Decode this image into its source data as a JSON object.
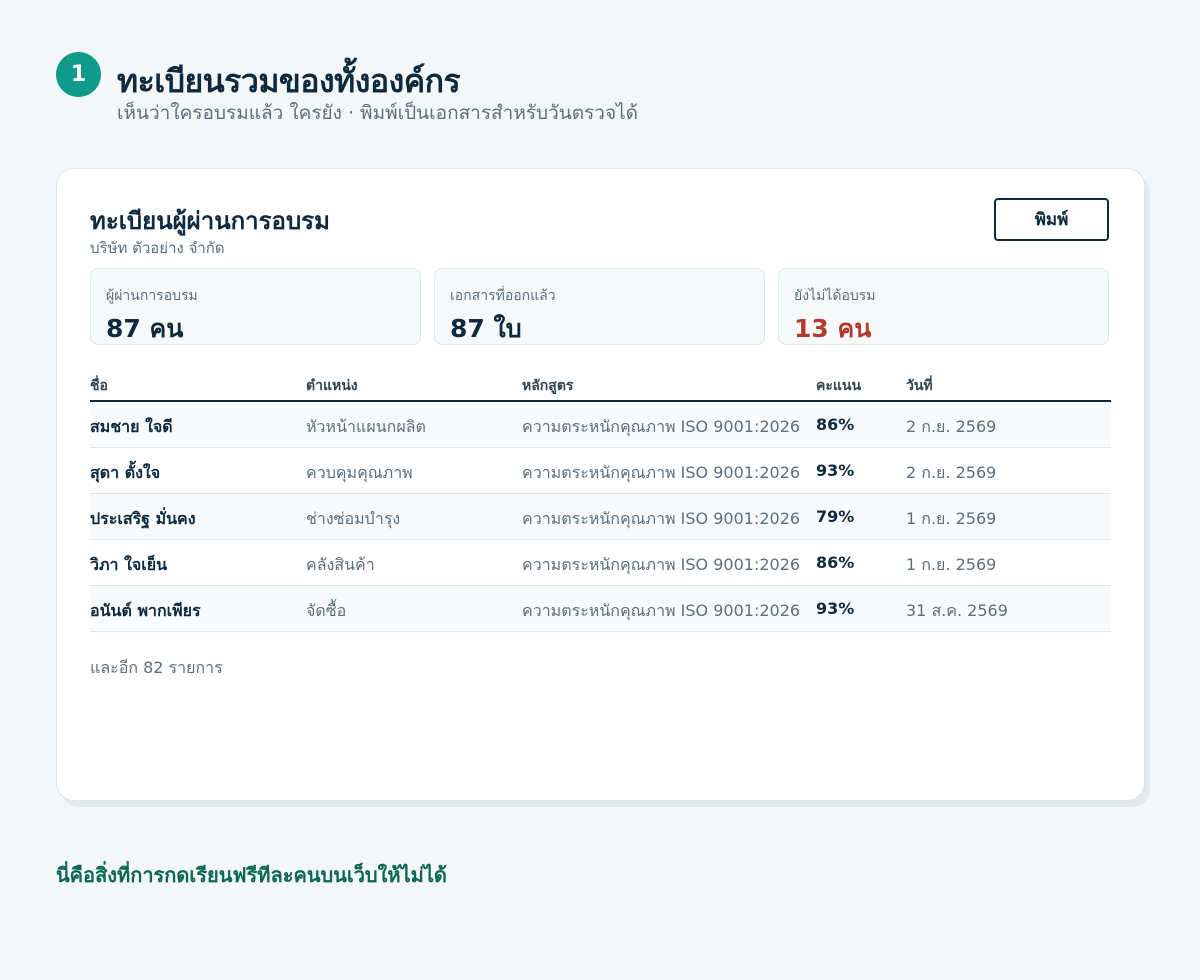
{
  "step": {
    "number": "1"
  },
  "header": {
    "title": "ทะเบียนรวมของทั้งองค์กร",
    "subtitle": "เห็นว่าใครอบรมแล้ว ใครยัง · พิมพ์เป็นเอกสารสำหรับวันตรวจได้"
  },
  "card": {
    "title": "ทะเบียนผู้ผ่านการอบรม",
    "company": "บริษัท ตัวอย่าง จำกัด",
    "print_label": "พิมพ์"
  },
  "stats": [
    {
      "label": "ผู้ผ่านการอบรม",
      "value": "87 คน"
    },
    {
      "label": "เอกสารที่ออกแล้ว",
      "value": "87 ใบ"
    },
    {
      "label": "ยังไม่ได้อบรม",
      "value": "13 คน"
    }
  ],
  "table": {
    "headers": [
      "ชื่อ",
      "ตำแหน่ง",
      "หลักสูตร",
      "คะแนน",
      "วันที่"
    ],
    "rows": [
      {
        "name": "สมชาย ใจดี",
        "position": "หัวหน้าแผนกผลิต",
        "course": "ความตระหนักคุณภาพ ISO 9001:2026",
        "score": "86%",
        "date": "2 ก.ย. 2569"
      },
      {
        "name": "สุดา ตั้งใจ",
        "position": "ควบคุมคุณภาพ",
        "course": "ความตระหนักคุณภาพ ISO 9001:2026",
        "score": "93%",
        "date": "2 ก.ย. 2569"
      },
      {
        "name": "ประเสริฐ มั่นคง",
        "position": "ช่างซ่อมบำรุง",
        "course": "ความตระหนักคุณภาพ ISO 9001:2026",
        "score": "79%",
        "date": "1 ก.ย. 2569"
      },
      {
        "name": "วิภา ใจเย็น",
        "position": "คลังสินค้า",
        "course": "ความตระหนักคุณภาพ ISO 9001:2026",
        "score": "86%",
        "date": "1 ก.ย. 2569"
      },
      {
        "name": "อนันต์ พากเพียร",
        "position": "จัดซื้อ",
        "course": "ความตระหนักคุณภาพ ISO 9001:2026",
        "score": "93%",
        "date": "31 ส.ค. 2569"
      }
    ],
    "more_text": "และอีก 82 รายการ"
  },
  "footer": {
    "text": "นี่คือสิ่งที่การกดเรียนฟรีทีละคนบนเว็บให้ไม่ได้"
  },
  "colors": {
    "accent": "#0f9a8a",
    "primary_text": "#0e2a3f",
    "alert": "#b23a2e",
    "footer_text": "#0b6655"
  }
}
